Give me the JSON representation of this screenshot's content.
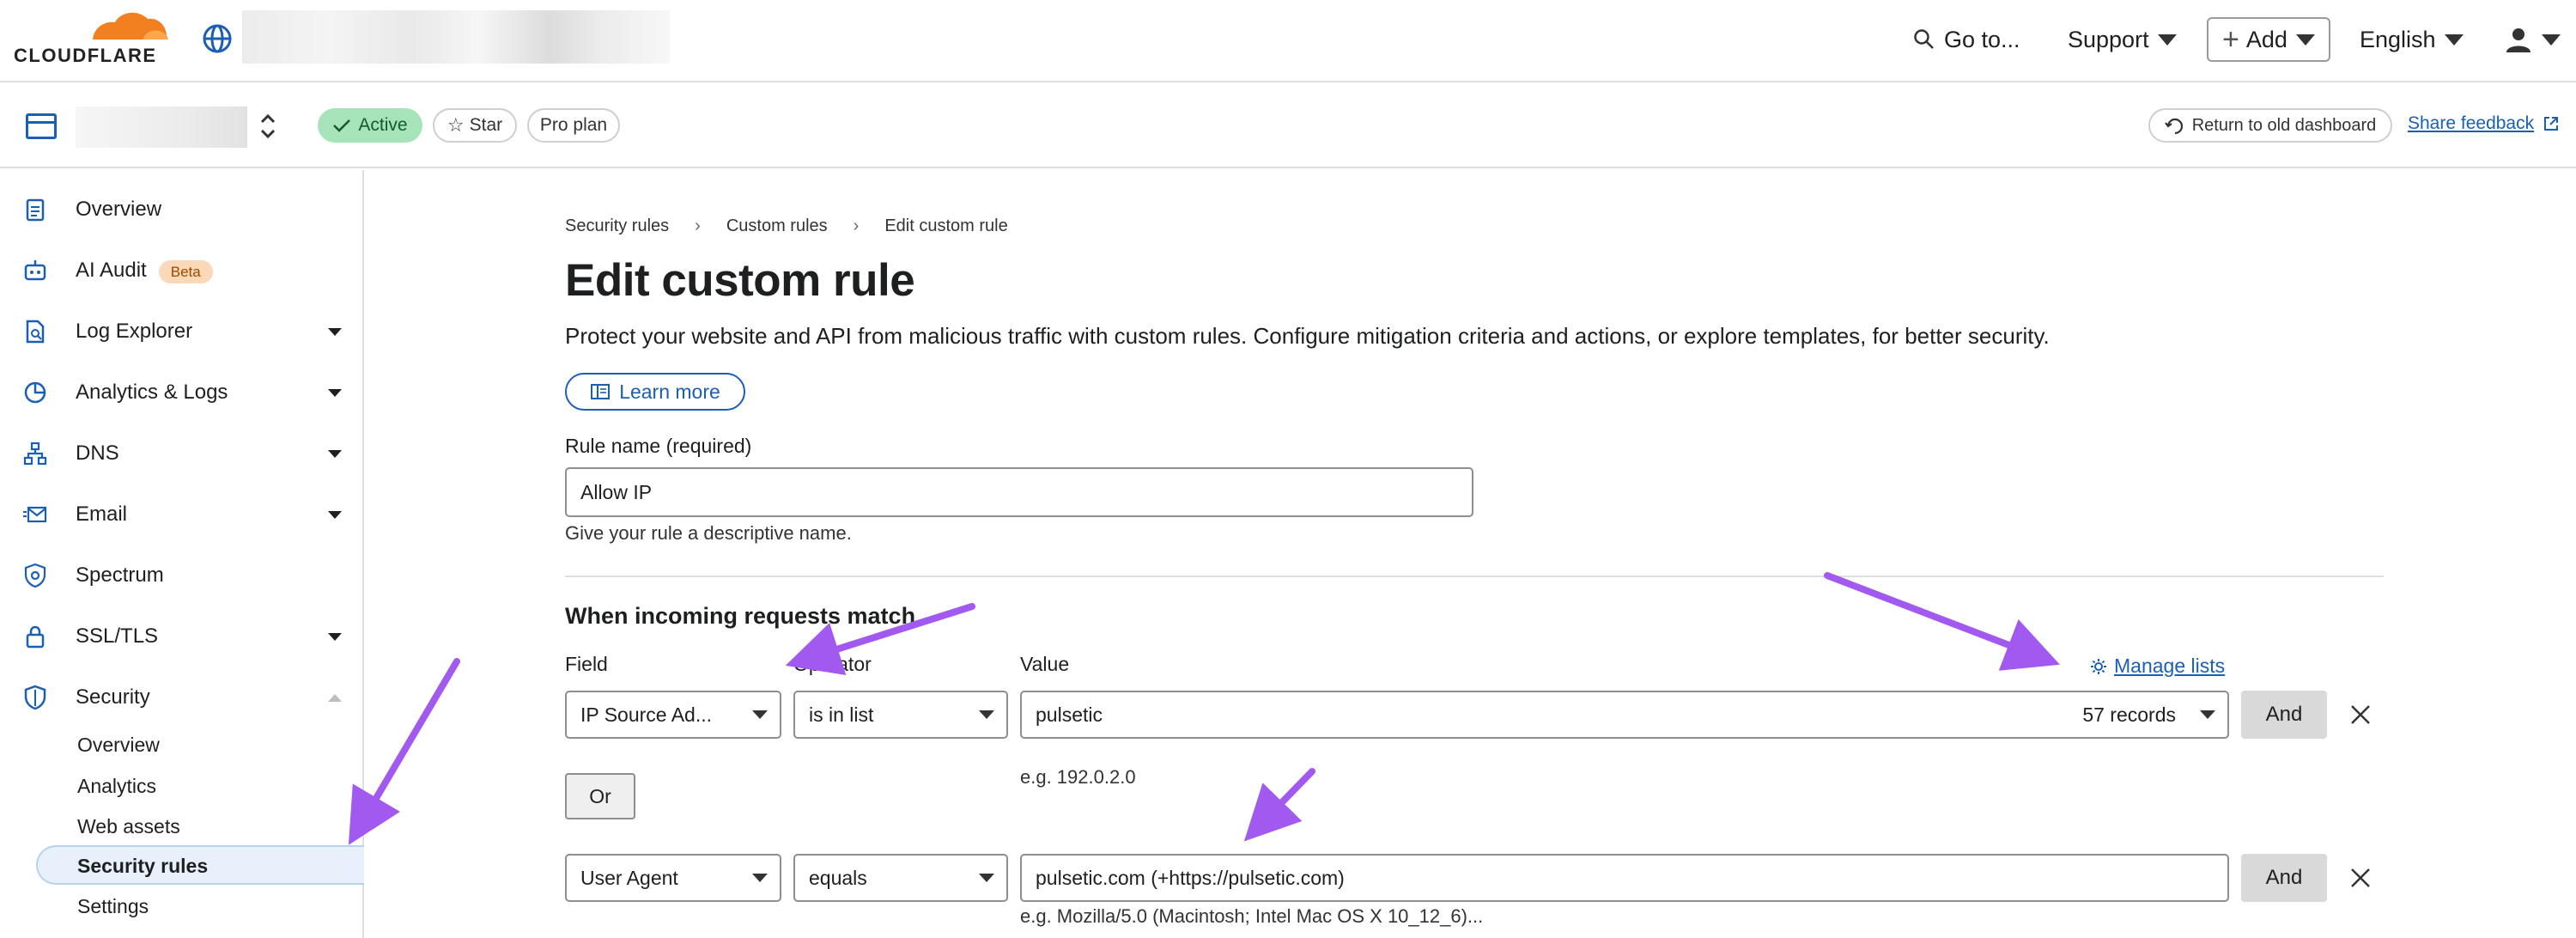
{
  "brand": {
    "logo_text": "CLOUDFLARE",
    "accent": "#f38020"
  },
  "header": {
    "goto": "Go to...",
    "support": "Support",
    "add": "Add",
    "language": "English"
  },
  "zone": {
    "status": "Active",
    "star": "Star",
    "plan": "Pro plan",
    "old_dashboard": "Return to old dashboard",
    "share_feedback": "Share feedback"
  },
  "sidebar": {
    "items": [
      {
        "label": "Overview"
      },
      {
        "label": "AI Audit",
        "badge": "Beta"
      },
      {
        "label": "Log Explorer"
      },
      {
        "label": "Analytics & Logs"
      },
      {
        "label": "DNS"
      },
      {
        "label": "Email"
      },
      {
        "label": "Spectrum"
      },
      {
        "label": "SSL/TLS"
      },
      {
        "label": "Security"
      }
    ],
    "security_sub": [
      "Overview",
      "Analytics",
      "Web assets",
      "Security rules",
      "Settings"
    ]
  },
  "breadcrumb": [
    "Security rules",
    "Custom rules",
    "Edit custom rule"
  ],
  "page": {
    "title": "Edit custom rule",
    "description": "Protect your website and API from malicious traffic with custom rules. Configure mitigation criteria and actions, or explore templates, for better security.",
    "learn_more": "Learn more"
  },
  "form": {
    "rule_name_label": "Rule name (required)",
    "rule_name_value": "Allow IP",
    "rule_name_hint": "Give your rule a descriptive name.",
    "match_title": "When incoming requests match",
    "col_field": "Field",
    "col_operator": "Operator",
    "col_value": "Value",
    "manage_lists": "Manage lists",
    "row1": {
      "field": "IP Source Ad...",
      "operator": "is in list",
      "value": "pulsetic",
      "records": "57 records",
      "hint": "e.g. 192.0.2.0"
    },
    "or": "Or",
    "row2": {
      "field": "User Agent",
      "operator": "equals",
      "value": "pulsetic.com (+https://pulsetic.com)",
      "hint": "e.g. Mozilla/5.0 (Macintosh; Intel Mac OS X 10_12_6)..."
    },
    "and": "And"
  },
  "annotation_color": "#a259f0"
}
